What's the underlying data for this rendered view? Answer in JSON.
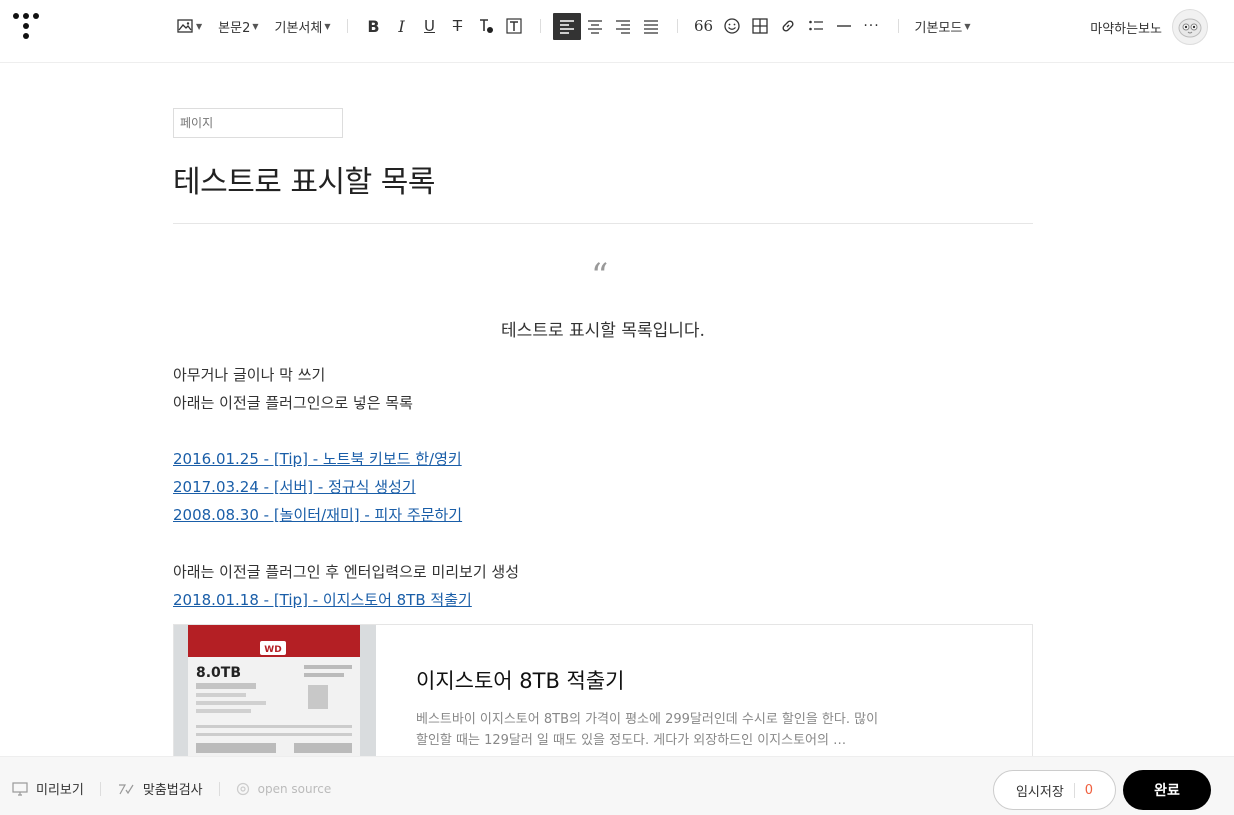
{
  "toolbar": {
    "paragraph_style": "본문2",
    "font": "기본서체",
    "mode": "기본모드",
    "quote_glyph": "66",
    "more_glyph": "···"
  },
  "user": {
    "name": "마약하는보노"
  },
  "editor": {
    "category_placeholder": "페이지",
    "title": "테스트로 표시할 목록",
    "quote_mark": "“",
    "quote_text": "테스트로 표시할 목록입니다.",
    "intro_lines": [
      "아무거나 글이나 막 쓰기",
      "아래는 이전글 플러그인으로 넣은 목록"
    ],
    "links": [
      "2016.01.25 - [Tip] - 노트북 키보드 한/영키",
      "2017.03.24 - [서버] - 정규식 생성기",
      "2008.08.30 - [놀이터/재미] - 피자 주문하기"
    ],
    "preview_intro": "아래는 이전글 플러그인 후 엔터입력으로 미리보기 생성",
    "preview_link": "2018.01.18 - [Tip] - 이지스토어 8TB 적출기",
    "card": {
      "img_label": "8.0TB",
      "img_brand": "WD",
      "title": "이지스토어 8TB 적출기",
      "desc": "베스트바이 이지스토어 8TB의 가격이 평소에 299달러인데 수시로 할인을 한다. 많이 할인할 때는 129달러 일 때도 있을 정도다. 게다가 외장하드인 이지스토어의 …"
    }
  },
  "bottom": {
    "preview": "미리보기",
    "spellcheck": "맞춤법검사",
    "open_source": "open source",
    "save": "임시저장",
    "save_count": "0",
    "done": "완료"
  }
}
